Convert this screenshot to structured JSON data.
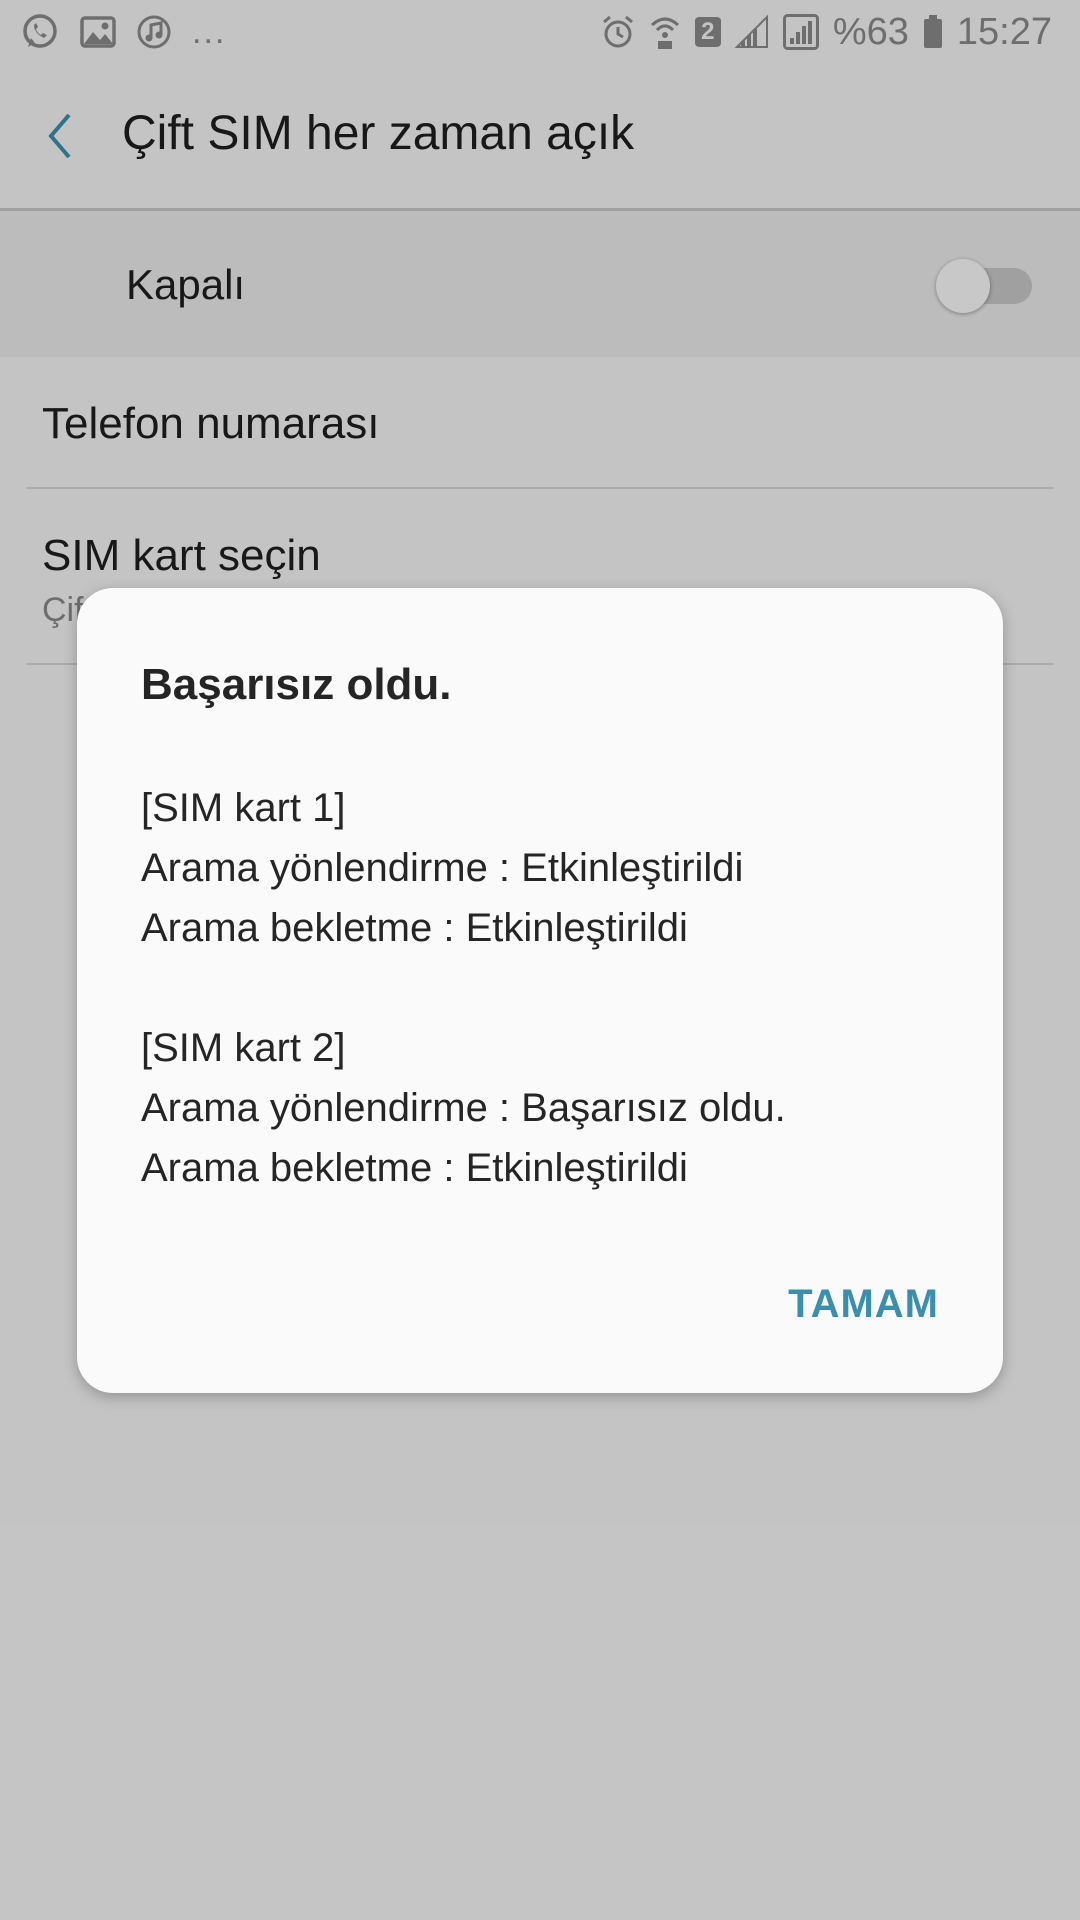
{
  "status_bar": {
    "left_icons": [
      "whatsapp-icon",
      "gallery-icon",
      "music-icon"
    ],
    "more": "...",
    "right_icons": [
      "alarm-icon",
      "wifi-calling-icon",
      "sim2-icon",
      "signal-sim1-icon",
      "signal-sim2-icon",
      "battery-icon"
    ],
    "sim_badge": "2",
    "battery": "%63",
    "time": "15:27"
  },
  "app_bar": {
    "back_icon": "chevron-left-icon",
    "title": "Çift SIM her zaman açık",
    "accent_color": "#3a8fae"
  },
  "master_switch": {
    "label": "Kapalı",
    "state": "off"
  },
  "settings": {
    "phone_number": {
      "title": "Telefon numarası"
    },
    "sim_select": {
      "title": "SIM kart seçin",
      "summary": "Çif"
    }
  },
  "dialog": {
    "title": "Başarısız oldu.",
    "sim1": {
      "header": "[SIM kart 1]",
      "forwarding": "Arama yönlendirme : Etkinleştirildi",
      "waiting": "Arama bekletme : Etkinleştirildi"
    },
    "sim2": {
      "header": "[SIM kart 2]",
      "forwarding": "Arama yönlendirme : Başarısız oldu.",
      "waiting": "Arama bekletme : Etkinleştirildi"
    },
    "ok_label": "TAMAM"
  }
}
